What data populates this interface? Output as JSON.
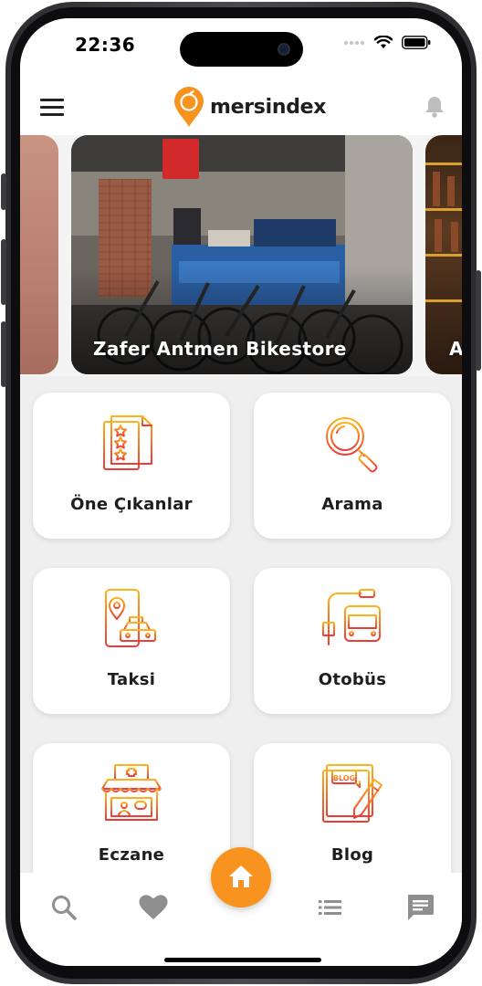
{
  "status_bar": {
    "time": "22:36"
  },
  "header": {
    "brand": "mersindex",
    "menu_icon": "menu-icon",
    "notification_icon": "bell-icon"
  },
  "colors": {
    "accent": "#f7931e",
    "accent_gradient_start": "#ffb21a",
    "accent_gradient_end": "#ef3b36",
    "background": "#efefef"
  },
  "carousel": {
    "slides": [
      {
        "caption": ""
      },
      {
        "caption": "Zafer Antmen Bikestore"
      },
      {
        "caption": "A"
      }
    ]
  },
  "categories": [
    {
      "label": "Öne Çıkanlar",
      "icon": "featured-list-icon"
    },
    {
      "label": "Arama",
      "icon": "magnifier-icon"
    },
    {
      "label": "Taksi",
      "icon": "taxi-icon"
    },
    {
      "label": "Otobüs",
      "icon": "bus-stop-icon"
    },
    {
      "label": "Eczane",
      "icon": "pharmacy-icon"
    },
    {
      "label": "Blog",
      "icon": "blog-icon"
    }
  ],
  "bottom_nav": {
    "items": [
      {
        "icon": "search-icon"
      },
      {
        "icon": "heart-icon"
      },
      {
        "icon": "home-icon"
      },
      {
        "icon": "list-icon"
      },
      {
        "icon": "chat-icon"
      }
    ]
  }
}
